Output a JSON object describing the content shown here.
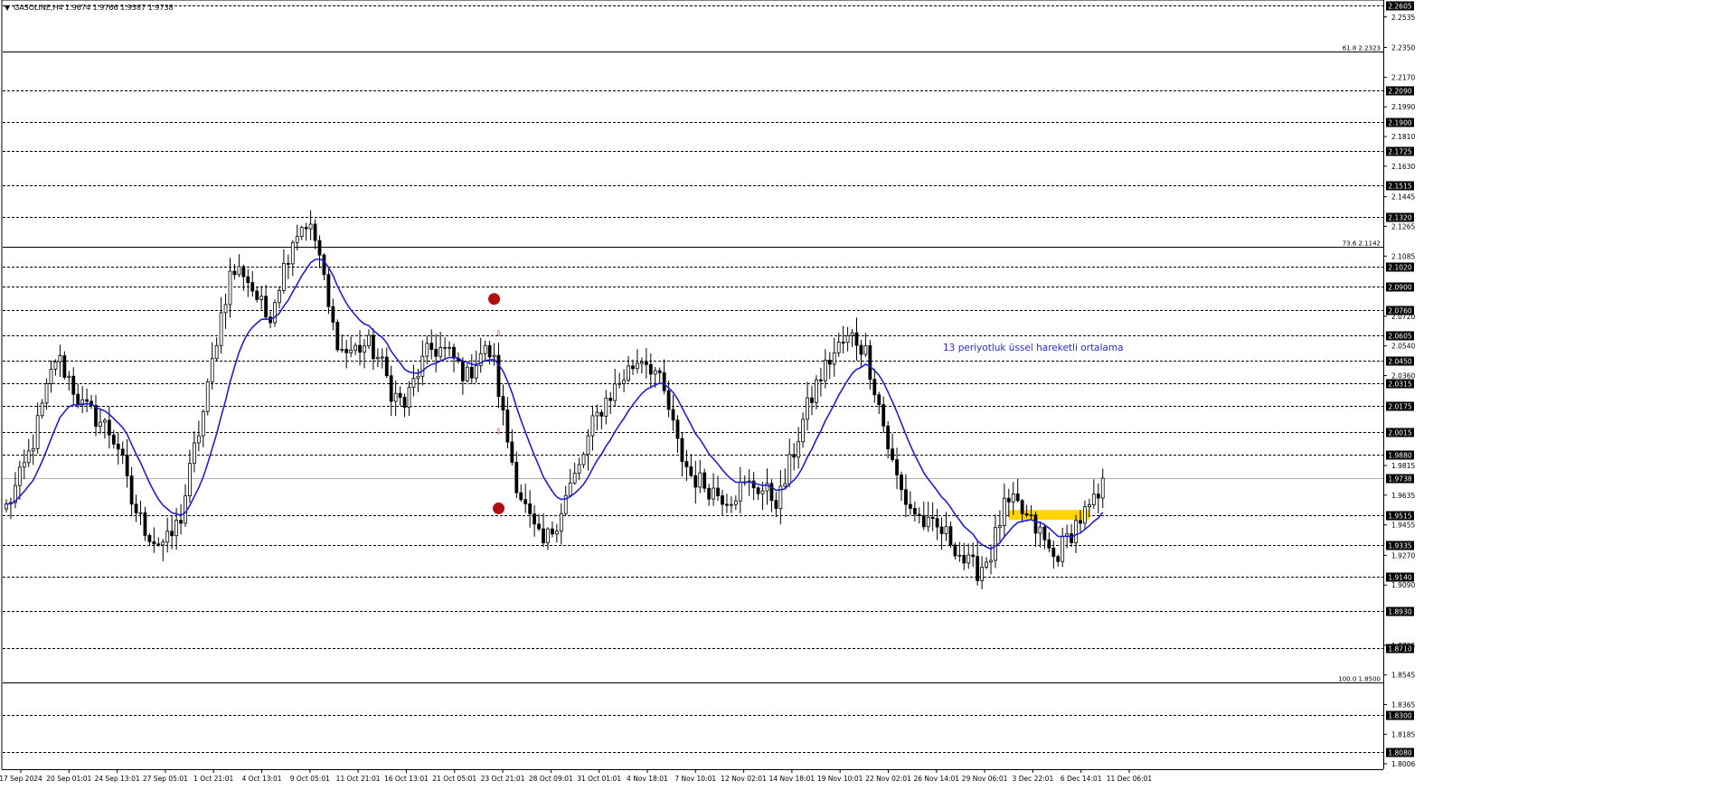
{
  "header": {
    "symbol_label": "GASOLINE,H4",
    "ohlc_label": "1.9674 1.9766 1.9587 1.9738"
  },
  "annotation": {
    "ema_label": "13 periyotluk üssel hareketli ortalama"
  },
  "colors": {
    "background": "#ffffff",
    "candle": "#000000",
    "ema_line": "#1f1fd6",
    "annotation_text": "#2a2ad8",
    "highlight_box": "#ffd400",
    "signal_marker": "#b01010",
    "label_box": "#000000",
    "label_text": "#ffffff",
    "grid_dashed": "#000000",
    "current_price_line": "#b0b0b0"
  },
  "chart_data": {
    "type": "candlestick",
    "symbol": "GASOLINE,H4",
    "ylim": [
      1.8006,
      2.2605
    ],
    "x_tick_labels": [
      "17 Sep 2024",
      "20 Sep 01:01",
      "24 Sep 13:01",
      "27 Sep 05:01",
      "1 Oct 21:01",
      "4 Oct 13:01",
      "9 Oct 05:01",
      "11 Oct 21:01",
      "16 Oct 13:01",
      "21 Oct 05:01",
      "23 Oct 21:01",
      "28 Oct 09:01",
      "31 Oct 01:01",
      "4 Nov 18:01",
      "7 Nov 10:01",
      "12 Nov 02:01",
      "14 Nov 18:01",
      "19 Nov 10:01",
      "22 Nov 02:01",
      "26 Nov 14:01",
      "29 Nov 06:01",
      "3 Dec 22:01",
      "6 Dec 14:01",
      "11 Dec 06:01"
    ],
    "y_tick_labels": [
      "2.2535",
      "2.2350",
      "2.2170",
      "2.1990",
      "2.1810",
      "2.1630",
      "2.1445",
      "2.1265",
      "2.1085",
      "2.0720",
      "2.0540",
      "2.0360",
      "1.9815",
      "1.9635",
      "1.9455",
      "1.9270",
      "1.9090",
      "1.8725",
      "1.8545",
      "1.8365",
      "1.8185",
      "1.8006"
    ],
    "horizontal_levels": [
      "2.2605",
      "2.2090",
      "2.1900",
      "2.1725",
      "2.1515",
      "2.1320",
      "2.1020",
      "2.0900",
      "2.0760",
      "2.0605",
      "2.0450",
      "2.0315",
      "2.0175",
      "2.0015",
      "1.9880",
      "1.9515",
      "1.9335",
      "1.9140",
      "1.8930",
      "1.8710",
      "1.8300",
      "1.8080"
    ],
    "fib_levels": [
      {
        "label": "61.8 2.2323",
        "value": 2.2323
      },
      {
        "label": "73.6 2.1142",
        "value": 2.1142
      },
      {
        "label": "100.0 1.8500",
        "value": 1.85
      }
    ],
    "current_price": {
      "label": "1.9738",
      "value": 1.9738
    },
    "ema_anchor_closes": [
      1.956,
      1.972,
      1.992,
      2.02,
      2.048,
      2.035,
      2.018,
      2.012,
      2.005,
      1.993,
      1.96,
      1.945,
      1.935,
      1.935,
      1.95,
      1.988,
      2.02,
      2.065,
      2.098,
      2.1,
      2.085,
      2.07,
      2.095,
      2.12,
      2.13,
      2.115,
      2.07,
      2.05,
      2.052,
      2.055,
      2.045,
      2.025,
      2.018,
      2.038,
      2.052,
      2.052,
      2.045,
      2.035,
      2.05,
      2.05,
      2.005,
      1.97,
      1.948,
      1.932,
      1.945,
      1.965,
      1.98,
      2.005,
      2.02,
      2.03,
      2.04,
      2.048,
      2.04,
      2.02,
      1.99,
      1.975,
      1.97,
      1.965,
      1.962,
      1.968,
      1.97,
      1.965,
      1.96,
      1.985,
      2.01,
      2.03,
      2.045,
      2.055,
      2.06,
      2.05,
      2.02,
      1.985,
      1.962,
      1.952,
      1.944,
      1.942,
      1.935,
      1.922,
      1.918,
      1.928,
      1.955,
      1.958,
      1.948,
      1.94,
      1.925,
      1.935,
      1.948,
      1.955,
      1.965
    ],
    "ema_period": 13,
    "highlight_zone": {
      "y_range": [
        1.9486,
        1.9545
      ],
      "x_candles": [
        224,
        242
      ]
    },
    "signal_markers": [
      {
        "type": "dot",
        "at_candle": 109,
        "value": 2.0825
      },
      {
        "type": "down-arrow",
        "at_candle": 110,
        "value": 2.0615
      },
      {
        "type": "down-arrow",
        "at_candle": 110,
        "value": 2.002
      },
      {
        "type": "dot",
        "at_candle": 110,
        "value": 1.9555
      }
    ]
  }
}
